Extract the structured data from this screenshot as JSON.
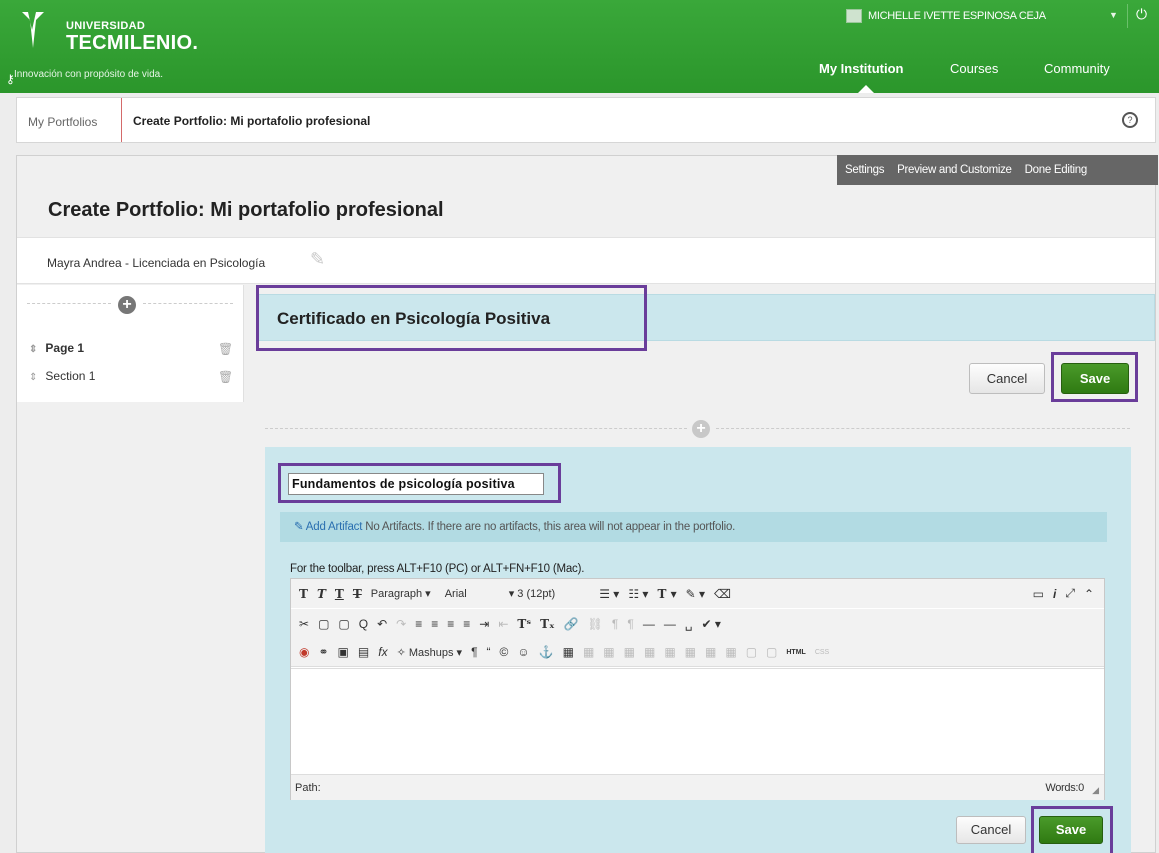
{
  "header": {
    "brand_small": "UNIVERSIDAD",
    "brand_big": "TECMILENIO.",
    "tagline": "Innovación con propósito de vida.",
    "user_name": "MICHELLE IVETTE ESPINOSA CEJA",
    "nav": [
      "My Institution",
      "Courses",
      "Community"
    ],
    "active_nav": "My Institution",
    "colors": {
      "brand_green": "#2f9e2f"
    }
  },
  "breadcrumb": {
    "root": "My Portfolios",
    "current": "Create Portfolio: Mi portafolio profesional"
  },
  "edit_tabs": [
    "Settings",
    "Preview and Customize",
    "Done Editing"
  ],
  "page": {
    "title": "Create Portfolio: Mi portafolio profesional",
    "subtitle": "Mayra Andrea - Licenciada en Psicología"
  },
  "sidebar": {
    "items": [
      {
        "label": "Page 1",
        "bold": true
      },
      {
        "label": "Section 1",
        "bold": false
      }
    ]
  },
  "section": {
    "title": "Certificado en Psicología Positiva",
    "cancel_label": "Cancel",
    "save_label": "Save"
  },
  "block": {
    "title_value": "Fundamentos de psicología positiva",
    "add_artifact": "Add Artifact",
    "artifact_note": "No Artifacts. If there are no artifacts, this area will not appear in the portfolio.",
    "toolbar_hint": "For the toolbar, press ALT+F10 (PC) or ALT+FN+F10 (Mac).",
    "format_select": "Paragraph",
    "font_select": "Arial",
    "size_select": "3 (12pt)",
    "mashups": "Mashups",
    "path_label": "Path:",
    "words": "Words:0",
    "cancel_label": "Cancel",
    "save_label": "Save"
  }
}
